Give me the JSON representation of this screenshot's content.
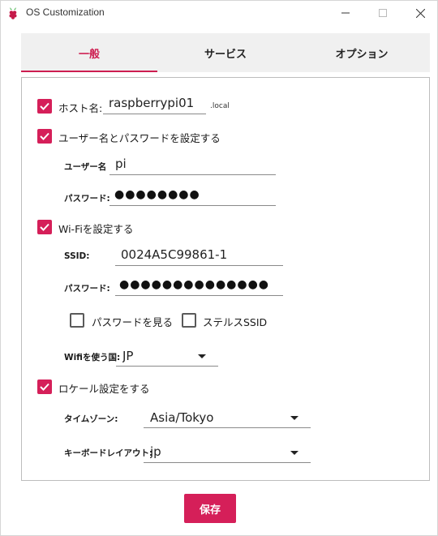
{
  "window": {
    "title": "OS Customization"
  },
  "tabs": [
    {
      "label": "一般",
      "active": true
    },
    {
      "label": "サービス",
      "active": false
    },
    {
      "label": "オプション",
      "active": false
    }
  ],
  "general": {
    "hostname": {
      "label": "ホスト名:",
      "value": "raspberrypi01",
      "suffix": ".local",
      "checked": true
    },
    "user": {
      "section_label": "ユーザー名とパスワードを設定する",
      "checked": true,
      "username_label": "ユーザー名",
      "username_value": "pi",
      "password_label": "パスワード:",
      "password_dots": "●●●●●●●●"
    },
    "wifi": {
      "section_label": "Wi-Fiを設定する",
      "checked": true,
      "ssid_label": "SSID:",
      "ssid_value": "0024A5C99861-1",
      "password_label": "パスワード:",
      "password_dots": "●●●●●●●●●●●●●●",
      "show_password_label": "パスワードを見る",
      "show_password_checked": false,
      "hidden_ssid_label": "ステルスSSID",
      "hidden_ssid_checked": false,
      "country_label": "Wifiを使う国:",
      "country_value": "JP"
    },
    "locale": {
      "section_label": "ロケール設定をする",
      "checked": true,
      "timezone_label": "タイムゾーン:",
      "timezone_value": "Asia/Tokyo",
      "keyboard_label": "キーボードレイアウト:",
      "keyboard_value": "jp"
    }
  },
  "footer": {
    "save_label": "保存"
  },
  "colors": {
    "accent": "#d51f59",
    "tab_bg": "#f0f0f0"
  },
  "icons": [
    "raspberry-icon",
    "minimize-icon",
    "maximize-icon",
    "close-icon",
    "checkmark-icon",
    "dropdown-caret-icon"
  ]
}
